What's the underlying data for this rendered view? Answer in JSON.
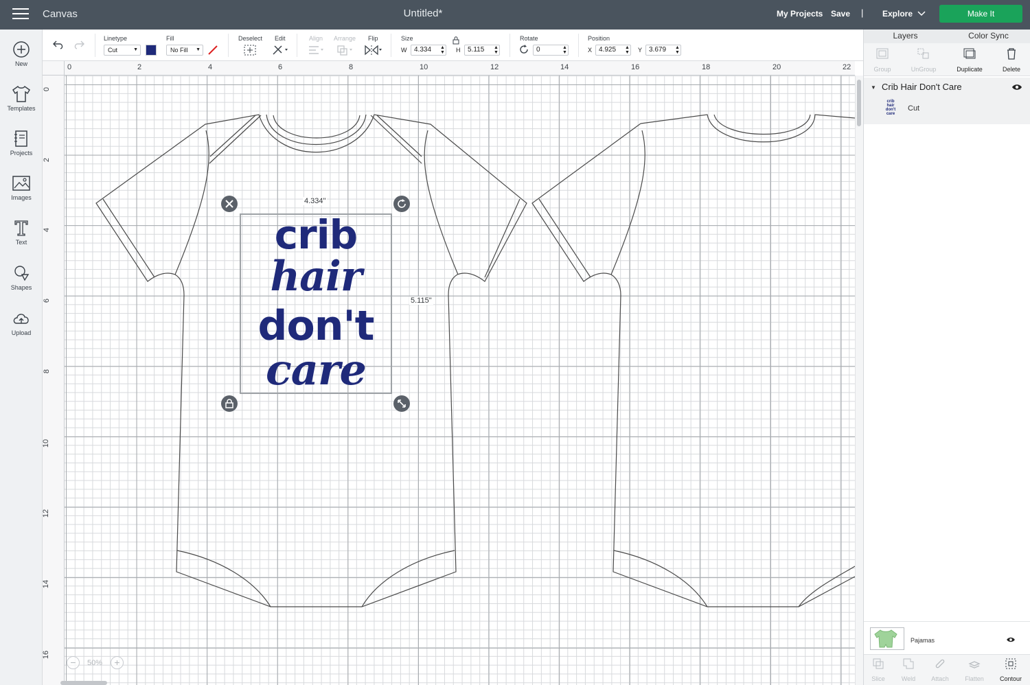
{
  "header": {
    "app_title": "Canvas",
    "doc_title": "Untitled*",
    "my_projects": "My Projects",
    "save": "Save",
    "separator": "|",
    "machine": "Explore",
    "make_it": "Make It",
    "make_it_color": "#1aa35a"
  },
  "leftbar": {
    "items": [
      {
        "label": "New",
        "icon": "plus-circle-icon"
      },
      {
        "label": "Templates",
        "icon": "tshirt-icon"
      },
      {
        "label": "Projects",
        "icon": "notebook-icon"
      },
      {
        "label": "Images",
        "icon": "image-icon"
      },
      {
        "label": "Text",
        "icon": "text-t-icon"
      },
      {
        "label": "Shapes",
        "icon": "shapes-icon"
      },
      {
        "label": "Upload",
        "icon": "cloud-upload-icon"
      }
    ]
  },
  "toolbar": {
    "linetype_label": "Linetype",
    "linetype_value": "Cut",
    "fill_label": "Fill",
    "fill_value": "No Fill",
    "color_swatch": "#1f2a7a",
    "deselect_label": "Deselect",
    "edit_label": "Edit",
    "align_label": "Align",
    "arrange_label": "Arrange",
    "flip_label": "Flip",
    "size_label": "Size",
    "w_axis": "W",
    "w_value": "4.334",
    "h_axis": "H",
    "h_value": "5.115",
    "rotate_label": "Rotate",
    "rotate_value": "0",
    "position_label": "Position",
    "x_axis": "X",
    "x_value": "4.925",
    "y_axis": "Y",
    "y_value": "3.679"
  },
  "ruler": {
    "top_ticks": [
      "0",
      "2",
      "4",
      "6",
      "8",
      "10",
      "12",
      "14",
      "16",
      "18",
      "20",
      "22"
    ],
    "left_ticks": [
      "0",
      "2",
      "4",
      "6",
      "8",
      "10",
      "12",
      "14",
      "16"
    ]
  },
  "canvas": {
    "width_label": "4.334\"",
    "height_label": "5.115\"",
    "design_lines": [
      "crib",
      "hair",
      "don't",
      "care"
    ],
    "zoom": "50%"
  },
  "right_panel": {
    "tab_layers": "Layers",
    "tab_color_sync": "Color Sync",
    "tools": [
      "Group",
      "UnGroup",
      "Duplicate",
      "Delete"
    ],
    "layer_group_name": "Crib Hair Don't Care",
    "layer_type": "Cut",
    "layer_thumb_text": [
      "crib",
      "hair",
      "don't",
      "care"
    ],
    "canvas_layer_name": "Pajamas",
    "bottom_tools": [
      "Slice",
      "Weld",
      "Attach",
      "Flatten",
      "Contour"
    ]
  }
}
